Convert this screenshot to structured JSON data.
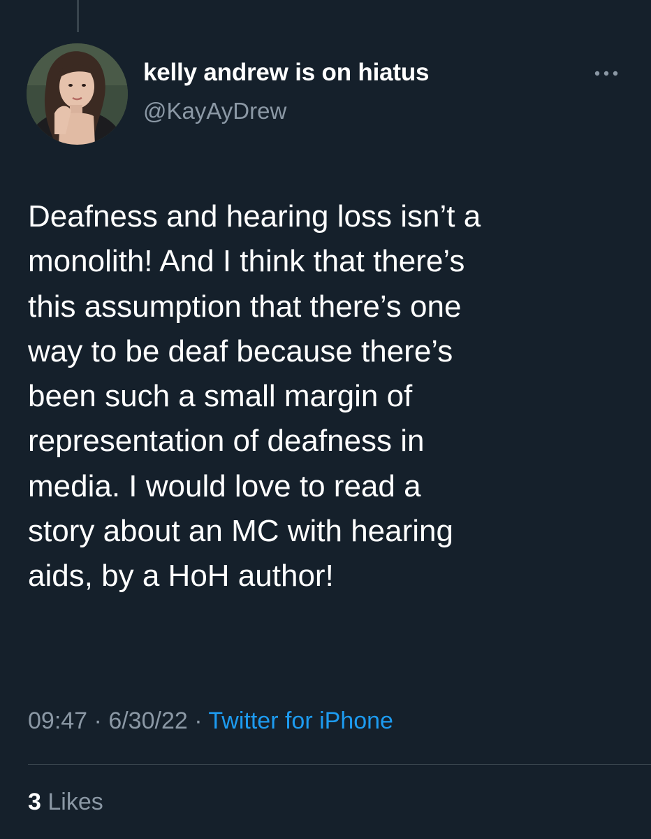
{
  "author": {
    "display_name": "kelly andrew is on hiatus",
    "handle": "@KayAyDrew"
  },
  "tweet": {
    "lines": [
      "Deafness and hearing loss isn’t a",
      "monolith! And I think that there’s",
      "this assumption that there’s one",
      "way to be deaf because there’s",
      "been such a small margin of",
      "representation of deafness in",
      "media. I would love to read a",
      "story about an MC with hearing",
      "aids, by a HoH author!"
    ]
  },
  "meta": {
    "time": "09:47",
    "separator": "·",
    "date": "6/30/22",
    "source": "Twitter for iPhone"
  },
  "engagement": {
    "likes_count": "3",
    "likes_label": "Likes"
  },
  "colors": {
    "background": "#15202b",
    "text_primary": "#ffffff",
    "text_secondary": "#8b98a5",
    "accent": "#1d9bf0",
    "divider": "#38444d"
  },
  "icons": {
    "more": "more-horizontal-icon"
  }
}
